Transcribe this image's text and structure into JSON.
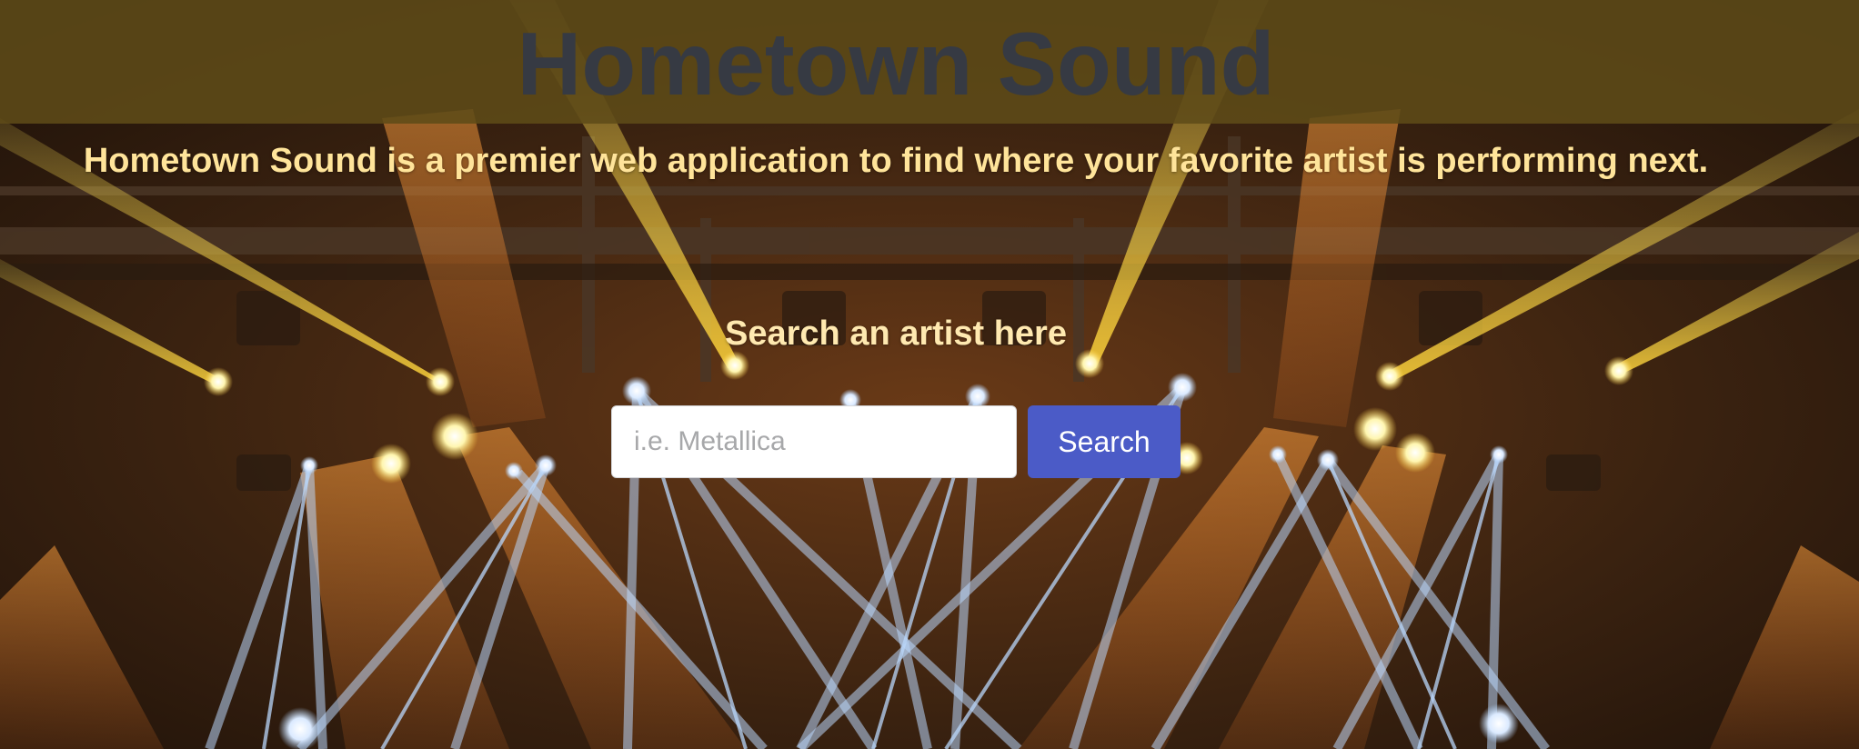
{
  "header": {
    "title": "Hometown Sound",
    "background_color": "#5f4b18"
  },
  "intro": {
    "tagline": "Hometown Sound is a premier web application to find where your favorite artist is performing next."
  },
  "search": {
    "heading": "Search an artist here",
    "input_value": "",
    "placeholder": "i.e. Metallica",
    "button_label": "Search",
    "button_color": "#4b5bc7"
  },
  "background": {
    "image": "concert-stage-lights",
    "colors": [
      "#f6c830",
      "#f08a30",
      "#a9cdf5",
      "#1d120b"
    ]
  }
}
